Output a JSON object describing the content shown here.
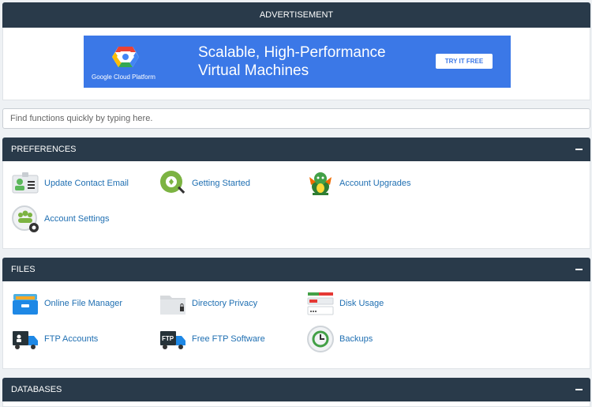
{
  "advertisement": {
    "header": "ADVERTISEMENT",
    "brand": "Google Cloud Platform",
    "headline_line1": "Scalable, High-Performance",
    "headline_line2": "Virtual Machines",
    "cta": "TRY IT FREE",
    "colors": {
      "banner": "#3b78e7"
    }
  },
  "search": {
    "placeholder": "Find functions quickly by typing here."
  },
  "sections": {
    "preferences": {
      "title": "PREFERENCES",
      "items": [
        {
          "label": "Update Contact Email",
          "icon": "contact-card-icon"
        },
        {
          "label": "Getting Started",
          "icon": "getting-started-icon"
        },
        {
          "label": "Account Upgrades",
          "icon": "dragon-icon"
        },
        {
          "label": "Account Settings",
          "icon": "account-settings-icon"
        }
      ]
    },
    "files": {
      "title": "FILES",
      "items": [
        {
          "label": "Online File Manager",
          "icon": "file-drawer-icon"
        },
        {
          "label": "Directory Privacy",
          "icon": "locked-folder-icon"
        },
        {
          "label": "Disk Usage",
          "icon": "disk-usage-icon"
        },
        {
          "label": "FTP Accounts",
          "icon": "ftp-truck-icon"
        },
        {
          "label": "Free FTP Software",
          "icon": "ftp-truck-label-icon"
        },
        {
          "label": "Backups",
          "icon": "backup-clock-icon"
        }
      ]
    },
    "databases": {
      "title": "DATABASES"
    }
  },
  "colors": {
    "header_bg": "#293a4a",
    "link": "#1f6fb2",
    "page_bg": "#eef1f4"
  }
}
